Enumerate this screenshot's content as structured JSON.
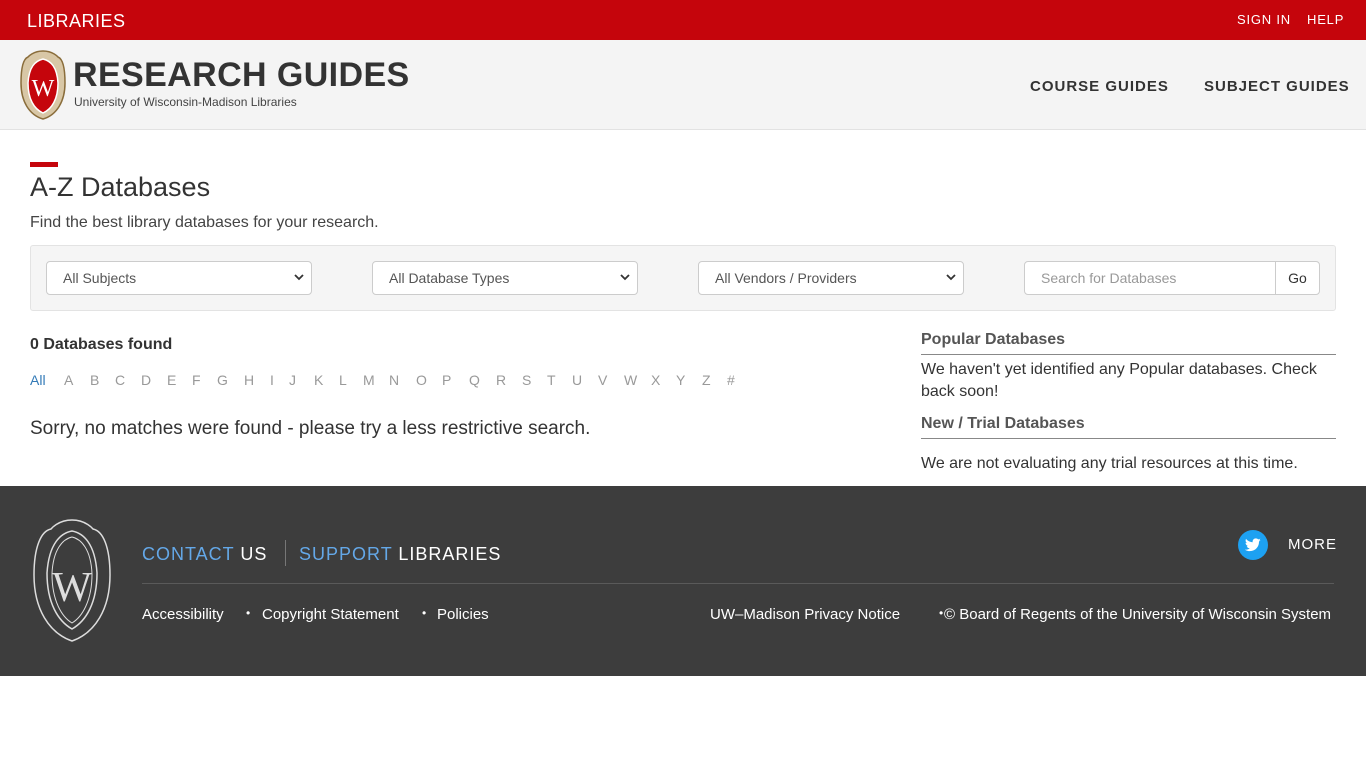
{
  "topbar": {
    "brand": "LIBRARIES",
    "sign_in": "SIGN IN",
    "help": "HELP",
    "color": "#c5050c"
  },
  "header": {
    "title": "RESEARCH GUIDES",
    "subtitle": "University of Wisconsin-Madison Libraries",
    "nav": [
      "COURSE GUIDES",
      "SUBJECT GUIDES"
    ],
    "logo_icon": "uw-crest-icon"
  },
  "page": {
    "title": "A-Z Databases",
    "description": "Find the best library databases for your research."
  },
  "filters": {
    "subjects": "All Subjects",
    "types": "All Database Types",
    "vendors": "All Vendors / Providers",
    "search_placeholder": "Search for Databases",
    "go_label": "Go"
  },
  "results": {
    "count_text": "0 Databases found",
    "letters": [
      "All",
      "A",
      "B",
      "C",
      "D",
      "E",
      "F",
      "G",
      "H",
      "I",
      "J",
      "K",
      "L",
      "M",
      "N",
      "O",
      "P",
      "Q",
      "R",
      "S",
      "T",
      "U",
      "V",
      "W",
      "X",
      "Y",
      "Z",
      "#"
    ],
    "active_letter": "All",
    "no_match": "Sorry, no matches were found - please try a less restrictive search."
  },
  "sidebar": {
    "popular_heading": "Popular Databases",
    "popular_text": "We haven't yet identified any Popular databases. Check back soon!",
    "trial_heading": "New / Trial Databases",
    "trial_text": "We are not evaluating any trial resources at this time."
  },
  "footer": {
    "contact_hl": "CONTACT",
    "contact_rest": "US",
    "support_hl": "SUPPORT",
    "support_rest": "LIBRARIES",
    "more": "MORE",
    "social_icon": "twitter-icon",
    "links": [
      "Accessibility",
      "Copyright Statement",
      "Policies"
    ],
    "privacy": "UW–Madison Privacy Notice",
    "copyright": "© Board of Regents of the University of Wisconsin System",
    "bullet": "•"
  }
}
